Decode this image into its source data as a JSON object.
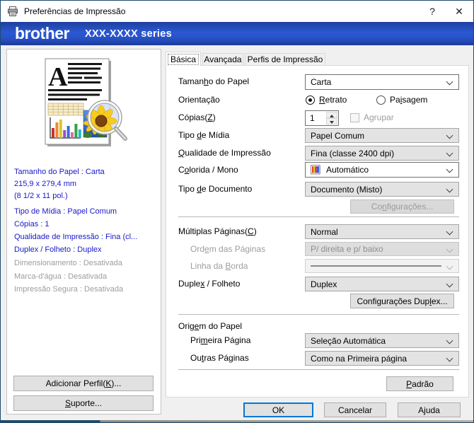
{
  "colors": {
    "brand_blue": "#2450c8",
    "summary_blue": "#1818cc",
    "focus_blue": "#0078d7",
    "window_border": "#1c4a6e"
  },
  "titlebar": {
    "title": "Preferências de Impressão",
    "help": "?",
    "close": "✕"
  },
  "header": {
    "logo": "brother",
    "model": "XXX-XXXX series"
  },
  "tabs": {
    "basic": "Básica",
    "advanced": "Avançada",
    "profiles": "Perfis de Impressão"
  },
  "summary": {
    "lines": [
      {
        "text": "Tamanho do Papel : Carta",
        "muted": false
      },
      {
        "text": "215,9 x 279,4 mm",
        "muted": false
      },
      {
        "text": "(8 1/2 x 11 pol.)",
        "muted": false
      },
      {
        "text": "Tipo de Mídia : Papel Comum",
        "muted": false
      },
      {
        "text": "Cópias : 1",
        "muted": false
      },
      {
        "text": "Qualidade de Impressão : Fina (cl...",
        "muted": false
      },
      {
        "text": "Duplex / Folheto : Duplex",
        "muted": false
      },
      {
        "text": "Dimensionamento : Desativada",
        "muted": true
      },
      {
        "text": "Marca-d'água : Desativada",
        "muted": true
      },
      {
        "text": "Impressão Segura : Desativada",
        "muted": true
      }
    ]
  },
  "fields": {
    "paper_size": {
      "label": "Taman&ho do Papel",
      "value": "Carta"
    },
    "orientation": {
      "label": "Orientação",
      "portrait": "&Retrato",
      "landscape": "Pa&isagem",
      "selected": "Retrato"
    },
    "copies": {
      "label": "Cópias(&Z)",
      "value": "1",
      "collate": "Agrupar"
    },
    "media_type": {
      "label": "Tipo &de Mídia",
      "value": "Papel Comum"
    },
    "quality": {
      "label": "&Qualidade de Impressão",
      "value": "Fina (classe 2400 dpi)"
    },
    "color_mono": {
      "label": "C&olorida / Mono",
      "value": "Automático"
    },
    "doc_type": {
      "label": "Tipo &de Documento",
      "value": "Documento (Misto)",
      "settings_button": "Co&nfigurações..."
    },
    "multipage": {
      "label": "Múltiplas Páginas(&C)",
      "value": "Normal"
    },
    "page_order": {
      "label": "Ord&em das Páginas",
      "value": "P/ direita e p/ baixo"
    },
    "border_line": {
      "label": "Linha da &Borda"
    },
    "duplex": {
      "label": "Duple&x / Folheto",
      "value": "Duplex",
      "settings_button": "Configurações Dup&lex..."
    },
    "paper_source": {
      "group_label": "Orig&em do Papel",
      "first_page": {
        "label": "Pri&meira Página",
        "value": "Seleção Automática"
      },
      "other_pages": {
        "label": "Ou&tras Páginas",
        "value": "Como na Primeira página"
      }
    },
    "default_button": "&Padrão"
  },
  "left_buttons": {
    "add_profile": "Adicionar Perfil(&K)...",
    "support": "&Suporte..."
  },
  "footer": {
    "ok": "OK",
    "cancel": "Cancelar",
    "help": "A&juda"
  }
}
